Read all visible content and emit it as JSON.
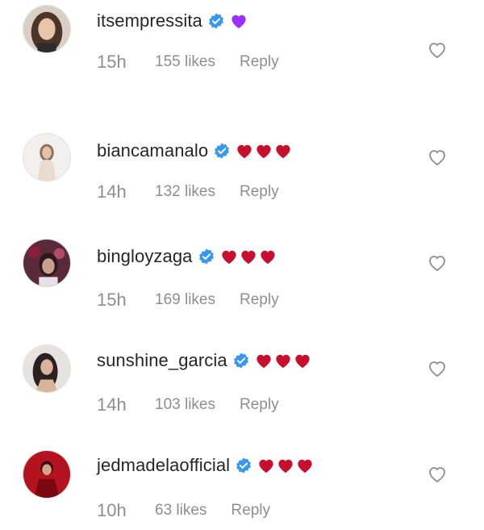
{
  "comments": [
    {
      "username": "itsempressita",
      "time": "15h",
      "likes": "155 likes",
      "reply": "Reply",
      "verified": true,
      "emoji": [
        "purple-heart"
      ],
      "colors": {
        "bg": "#d9cfc4",
        "fg": "#4a3528"
      }
    },
    {
      "username": "biancamanalo",
      "time": "14h",
      "likes": "132 likes",
      "reply": "Reply",
      "verified": true,
      "emoji": [
        "red-heart",
        "red-heart",
        "red-heart"
      ],
      "colors": {
        "bg": "#f2f0ee",
        "fg": "#8a6f5c"
      }
    },
    {
      "username": "bingloyzaga",
      "time": "15h",
      "likes": "169 likes",
      "reply": "Reply",
      "verified": true,
      "emoji": [
        "red-heart",
        "red-heart",
        "red-heart"
      ],
      "colors": {
        "bg": "#5a2a3a",
        "fg": "#c9a08a"
      }
    },
    {
      "username": "sunshine_garcia",
      "time": "14h",
      "likes": "103 likes",
      "reply": "Reply",
      "verified": true,
      "emoji": [
        "red-heart",
        "red-heart",
        "red-heart"
      ],
      "colors": {
        "bg": "#e6e2e0",
        "fg": "#2a2024"
      }
    },
    {
      "username": "jedmadelaofficial",
      "time": "10h",
      "likes": "63 likes",
      "reply": "Reply",
      "verified": true,
      "emoji": [
        "red-heart",
        "red-heart",
        "red-heart"
      ],
      "colors": {
        "bg": "#b3121e",
        "fg": "#3a0a0e"
      }
    }
  ],
  "theme": {
    "verified_blue": "#3897f0",
    "purple_heart": "#9b30ff",
    "red_heart": "#c8102e",
    "meta_gray": "#8e8e8e",
    "like_outline": "#8e8e8e"
  }
}
